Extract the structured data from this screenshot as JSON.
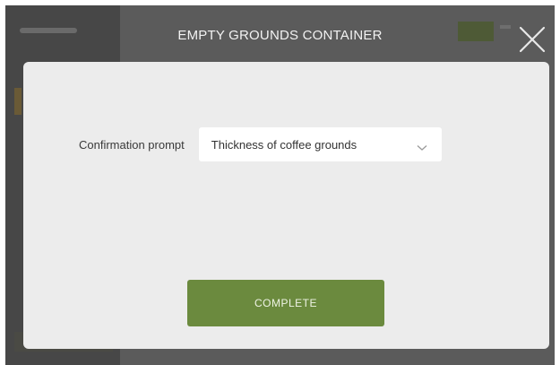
{
  "dialog": {
    "title": "EMPTY GROUNDS CONTAINER",
    "close_icon": "close-icon",
    "field_label": "Confirmation prompt",
    "select_value": "Thickness of coffee grounds",
    "select_icon": "chevron-down-icon",
    "complete_label": "COMPLETE"
  },
  "colors": {
    "overlay": "#5b5b5b",
    "card": "#ececec",
    "accent_green": "#6b8a3e"
  }
}
